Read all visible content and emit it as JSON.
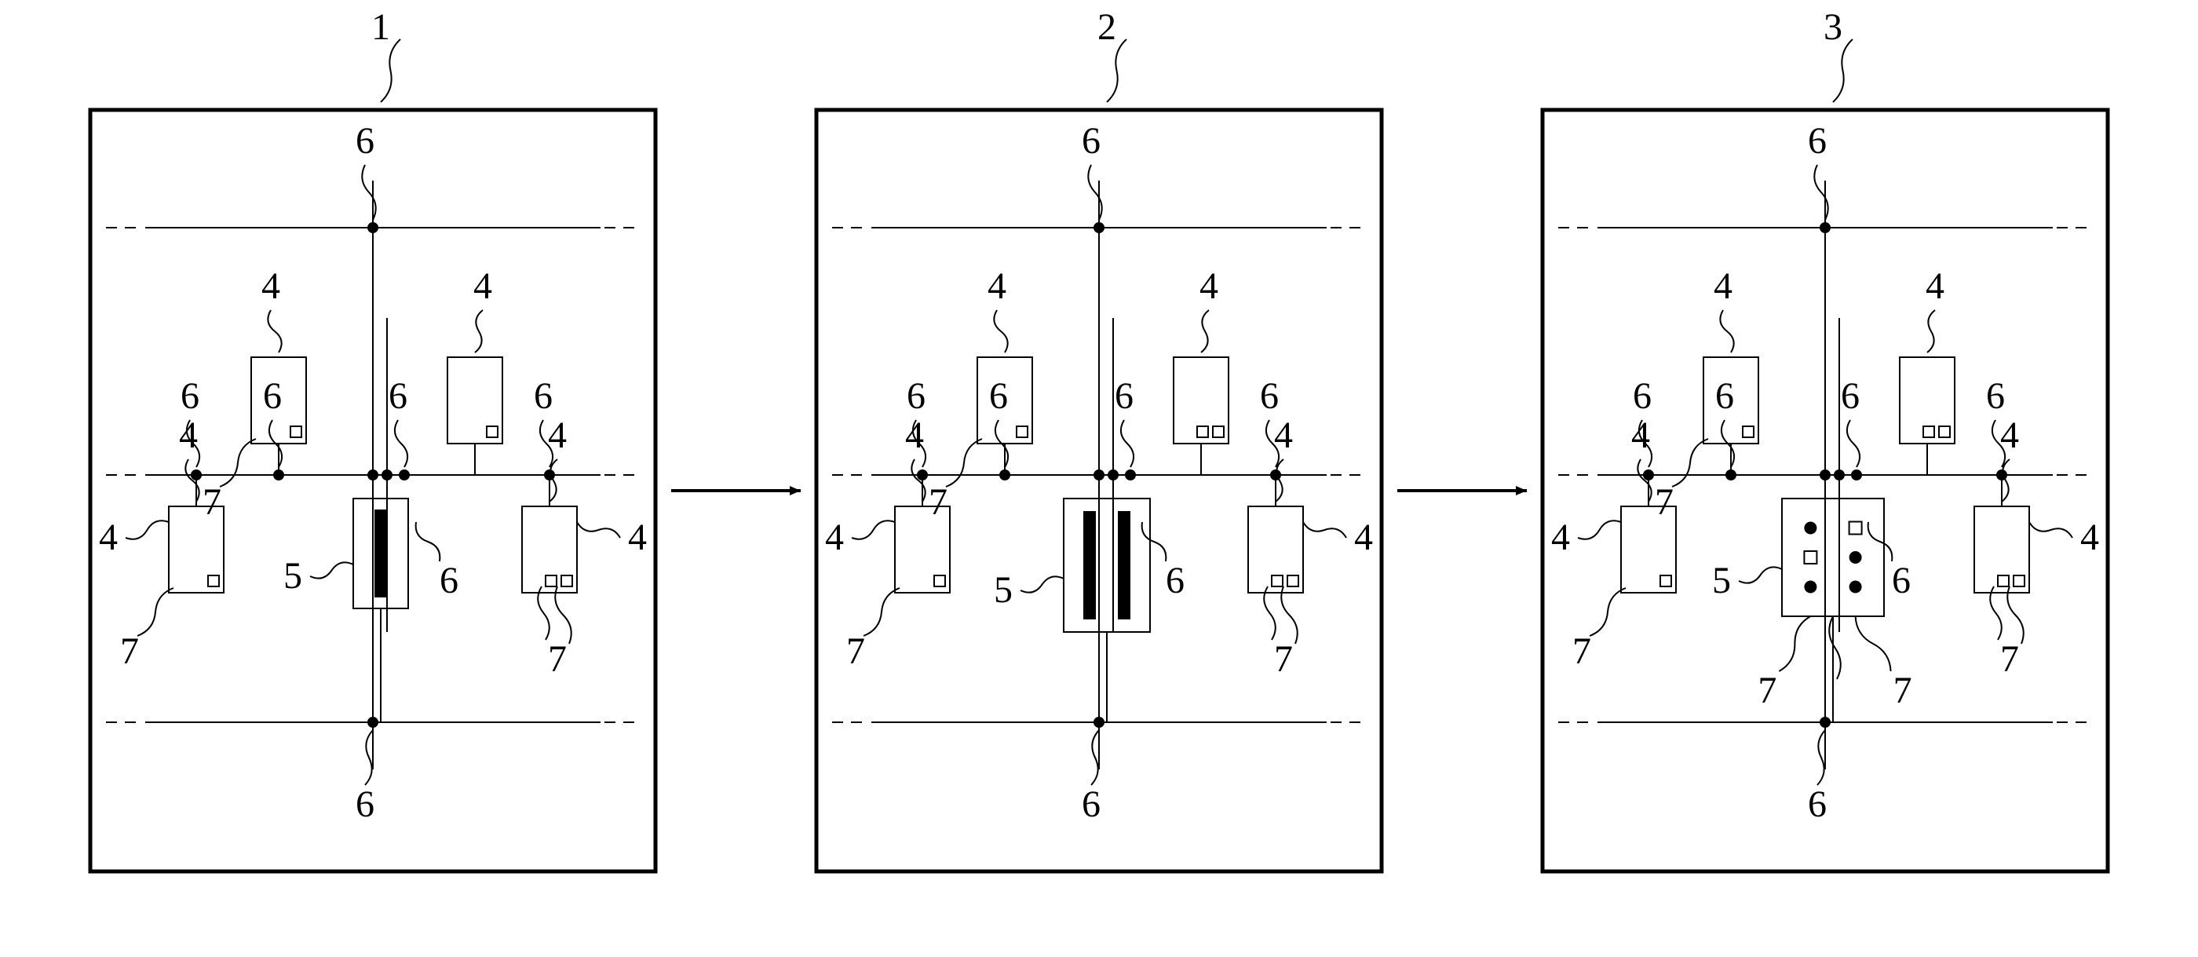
{
  "panels": [
    1,
    2,
    3
  ],
  "labels": {
    "1": "1",
    "2": "2",
    "3": "3",
    "4": "4",
    "5": "5",
    "6": "6",
    "7": "7"
  },
  "diagram_description": {
    "type": "schematic-grid-sequence",
    "panel_count": 3,
    "visible_labels": [
      "1",
      "2",
      "3",
      "4",
      "5",
      "6",
      "7"
    ],
    "leader_label": "6",
    "box_label": "4",
    "central_box_label": "5",
    "detail_label": "7"
  }
}
